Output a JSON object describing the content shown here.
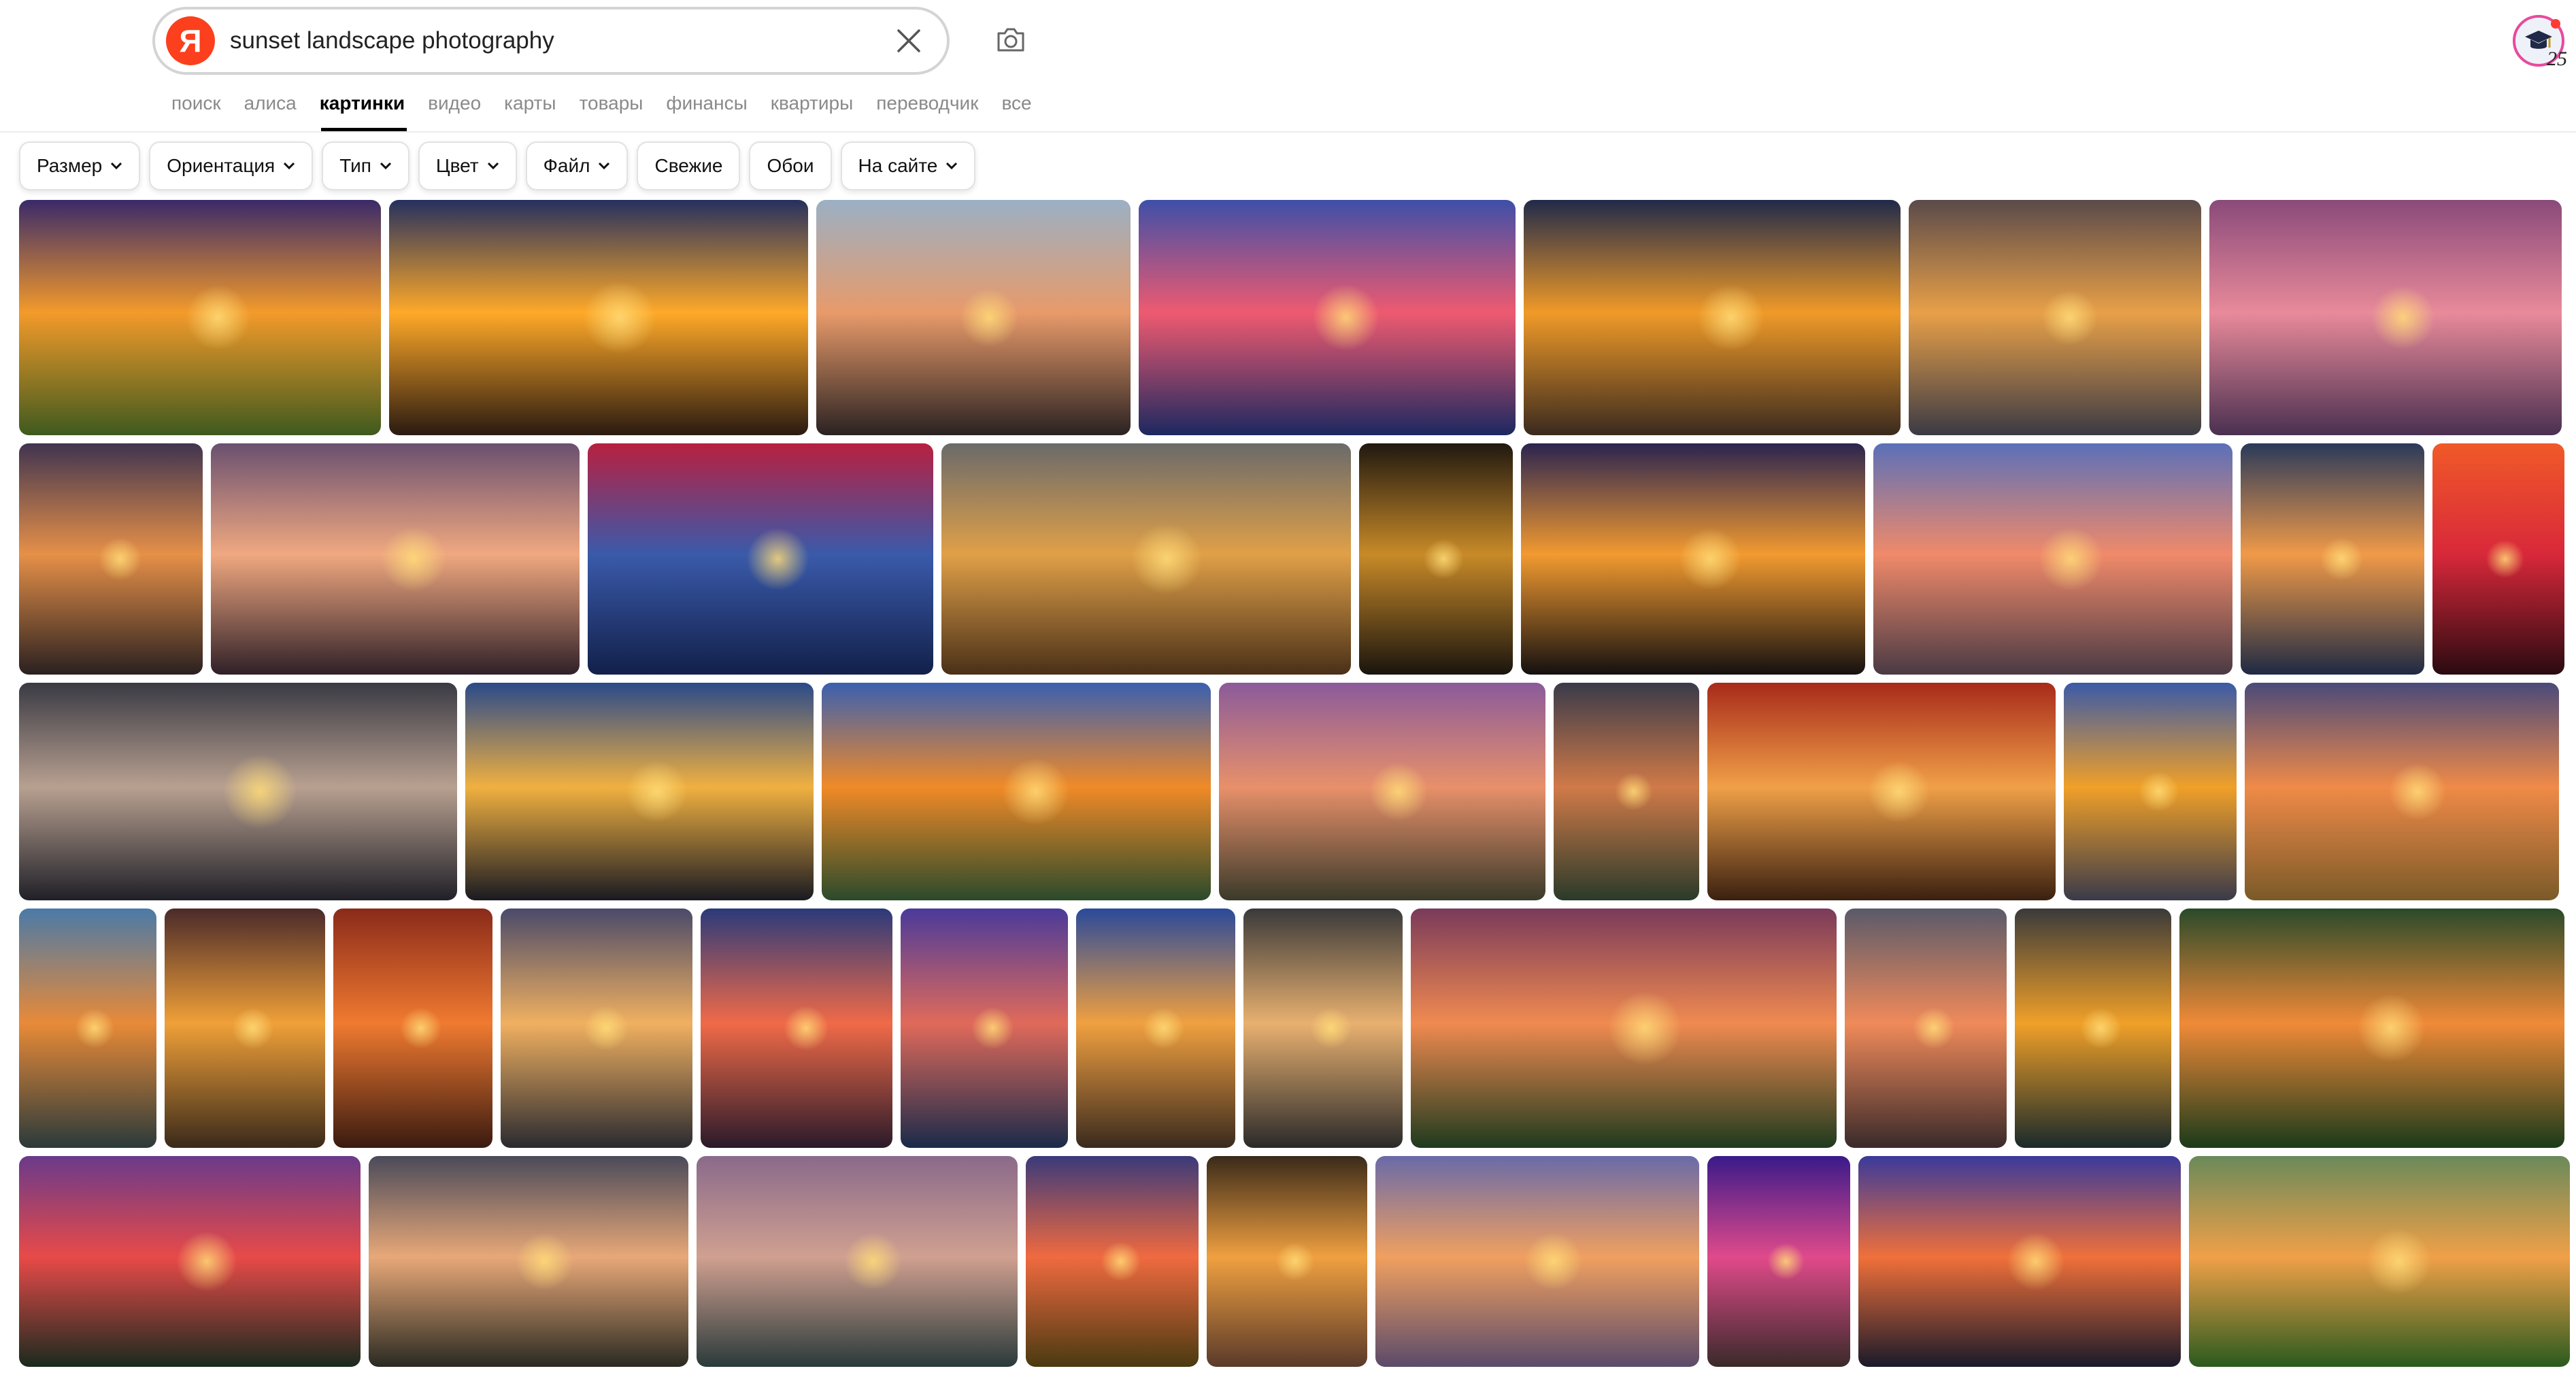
{
  "search": {
    "query": "sunset landscape photography"
  },
  "logo_letter": "Я",
  "avatar_badge": "25",
  "tabs": [
    {
      "label": "поиск"
    },
    {
      "label": "алиса"
    },
    {
      "label": "картинки",
      "active": true
    },
    {
      "label": "видео"
    },
    {
      "label": "карты"
    },
    {
      "label": "товары"
    },
    {
      "label": "финансы"
    },
    {
      "label": "квартиры"
    },
    {
      "label": "переводчик"
    },
    {
      "label": "все"
    }
  ],
  "filters": [
    {
      "label": "Размер",
      "dropdown": true
    },
    {
      "label": "Ориентация",
      "dropdown": true
    },
    {
      "label": "Тип",
      "dropdown": true
    },
    {
      "label": "Цвет",
      "dropdown": true
    },
    {
      "label": "Файл",
      "dropdown": true
    },
    {
      "label": "Свежие",
      "dropdown": false
    },
    {
      "label": "Обои",
      "dropdown": false
    },
    {
      "label": "На сайте",
      "dropdown": true
    }
  ],
  "colors": {
    "brand": "#fc3f1d",
    "avatar_ring": "#e84a9e"
  },
  "image_rows": [
    [
      {
        "c1": "#3a2a6a",
        "c2": "#f39a2a",
        "c3": "#3f5a1e"
      },
      {
        "c1": "#25305e",
        "c2": "#ffa928",
        "c3": "#2a1a10"
      },
      {
        "c1": "#9ab0c4",
        "c2": "#e89a6a",
        "c3": "#2a2222"
      },
      {
        "c1": "#3e4fa8",
        "c2": "#ee5a70",
        "c3": "#1c2860"
      },
      {
        "c1": "#202a4a",
        "c2": "#f09a28",
        "c3": "#3a2a1e"
      },
      {
        "c1": "#5a4a4a",
        "c2": "#e8a048",
        "c3": "#3a3a44"
      },
      {
        "c1": "#8a4a7a",
        "c2": "#e88a9a",
        "c3": "#4a3050"
      }
    ],
    [
      {
        "c1": "#403450",
        "c2": "#e69048",
        "c3": "#2a2020"
      },
      {
        "c1": "#6a5070",
        "c2": "#f0a880",
        "c3": "#302028"
      },
      {
        "c1": "#b82040",
        "c2": "#3a5aaa",
        "c3": "#12204a"
      },
      {
        "c1": "#6a6a6a",
        "c2": "#e0a048",
        "c3": "#4a3018"
      },
      {
        "c1": "#201810",
        "c2": "#c88a28",
        "c3": "#1a140e"
      },
      {
        "c1": "#2a2450",
        "c2": "#f29a30",
        "c3": "#141010"
      },
      {
        "c1": "#5a70b8",
        "c2": "#f08a6a",
        "c3": "#4a3a44"
      },
      {
        "c1": "#2a3a5a",
        "c2": "#f09a48",
        "c3": "#1e2a44"
      },
      {
        "c1": "#f05a28",
        "c2": "#d8283a",
        "c3": "#2a0a10"
      }
    ],
    [
      {
        "c1": "#3a3a44",
        "c2": "#b8a090",
        "c3": "#202028"
      },
      {
        "c1": "#2a4a8a",
        "c2": "#f0b040",
        "c3": "#1a1a22"
      },
      {
        "c1": "#3a60b0",
        "c2": "#f08a28",
        "c3": "#2a4a2a"
      },
      {
        "c1": "#8a5a9a",
        "c2": "#e8906a",
        "c3": "#3a3a2a"
      },
      {
        "c1": "#3a3a4a",
        "c2": "#d07a48",
        "c3": "#2a3a2a"
      },
      {
        "c1": "#a82a1a",
        "c2": "#f0a048",
        "c3": "#3a2010"
      },
      {
        "c1": "#3a5aa8",
        "c2": "#f0a028",
        "c3": "#3a3a4a"
      },
      {
        "c1": "#4a4a7a",
        "c2": "#f08a48",
        "c3": "#7a5a28"
      }
    ],
    [
      {
        "c1": "#4a7aa8",
        "c2": "#e88a38",
        "c3": "#2a3a3a"
      },
      {
        "c1": "#4a2a2a",
        "c2": "#f0a038",
        "c3": "#3a2a1a"
      },
      {
        "c1": "#8a2a1a",
        "c2": "#f07a30",
        "c3": "#3a1a10"
      },
      {
        "c1": "#4a4a6a",
        "c2": "#f0b060",
        "c3": "#2a2a30"
      },
      {
        "c1": "#2a3a7a",
        "c2": "#f06a48",
        "c3": "#2a1a2a"
      },
      {
        "c1": "#4a3a9a",
        "c2": "#e06a5a",
        "c3": "#1a2a4a"
      },
      {
        "c1": "#2a4a9a",
        "c2": "#f0a040",
        "c3": "#3a2a1e"
      },
      {
        "c1": "#3a3a3a",
        "c2": "#e8b070",
        "c3": "#2a2a2a"
      },
      {
        "c1": "#7a3a5a",
        "c2": "#f08a50",
        "c3": "#1e3a1e"
      },
      {
        "c1": "#5a5a6a",
        "c2": "#f08a5a",
        "c3": "#3a2a2a"
      },
      {
        "c1": "#3a3a3a",
        "c2": "#f0a028",
        "c3": "#1a2a2a"
      },
      {
        "c1": "#2a4a2a",
        "c2": "#f08a38",
        "c3": "#1a3a1a"
      }
    ],
    [
      {
        "c1": "#6a3a8a",
        "c2": "#e84a48",
        "c3": "#1a2a1e"
      },
      {
        "c1": "#4a4a5a",
        "c2": "#e8a878",
        "c3": "#2a2a22"
      },
      {
        "c1": "#8a6a8a",
        "c2": "#d0a090",
        "c3": "#2a3a3a"
      },
      {
        "c1": "#3a3a7a",
        "c2": "#f06a40",
        "c3": "#4a3a10"
      },
      {
        "c1": "#3a2a1a",
        "c2": "#f0a040",
        "c3": "#5a3a2a"
      },
      {
        "c1": "#6a6aa8",
        "c2": "#f0a060",
        "c3": "#5a4a6a"
      },
      {
        "c1": "#3a1a8a",
        "c2": "#e04a8a",
        "c3": "#3a2a2a"
      },
      {
        "c1": "#3a3a9a",
        "c2": "#f0703a",
        "c3": "#1a1a2a"
      },
      {
        "c1": "#6a8a5a",
        "c2": "#f0a048",
        "c3": "#2a5a1e"
      }
    ]
  ]
}
